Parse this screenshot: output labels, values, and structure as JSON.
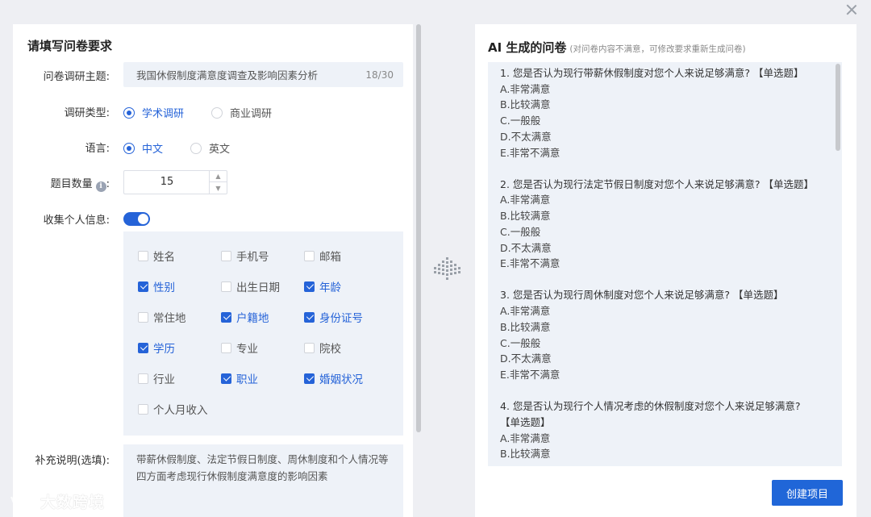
{
  "form": {
    "title": "请填写问卷要求",
    "topic": {
      "label": "问卷调研主题:",
      "value": "我国休假制度满意度调查及影响因素分析",
      "counter": "18/30"
    },
    "survey_type": {
      "label": "调研类型:",
      "options": [
        "学术调研",
        "商业调研"
      ],
      "selected": "学术调研"
    },
    "language": {
      "label": "语言:",
      "options": [
        "中文",
        "英文"
      ],
      "selected": "中文"
    },
    "question_count": {
      "label": "题目数量",
      "label_suffix": ":",
      "info_icon": "info-icon",
      "value": "15"
    },
    "collect_personal": {
      "label": "收集个人信息:",
      "enabled": true
    },
    "personal_fields": [
      {
        "label": "姓名",
        "checked": false
      },
      {
        "label": "手机号",
        "checked": false
      },
      {
        "label": "邮箱",
        "checked": false
      },
      {
        "label": "性别",
        "checked": true
      },
      {
        "label": "出生日期",
        "checked": false
      },
      {
        "label": "年龄",
        "checked": true
      },
      {
        "label": "常住地",
        "checked": false
      },
      {
        "label": "户籍地",
        "checked": true
      },
      {
        "label": "身份证号",
        "checked": true
      },
      {
        "label": "学历",
        "checked": true
      },
      {
        "label": "专业",
        "checked": false
      },
      {
        "label": "院校",
        "checked": false
      },
      {
        "label": "行业",
        "checked": false
      },
      {
        "label": "职业",
        "checked": true
      },
      {
        "label": "婚姻状况",
        "checked": true
      },
      {
        "label": "个人月收入",
        "checked": false
      }
    ],
    "note": {
      "label": "补充说明(选填):",
      "value": "带薪休假制度、法定节假日制度、周休制度和个人情况等四方面考虑现行休假制度满意度的影响因素"
    }
  },
  "result": {
    "title": "AI 生成的问卷",
    "subtitle": "(对问卷内容不满意，可修改要求重新生成问卷)",
    "questions": [
      {
        "stem": "1. 您是否认为现行带薪休假制度对您个人来说足够满意? 【单选题】",
        "options": [
          "A.非常满意",
          "B.比较满意",
          "C.一般般",
          "D.不太满意",
          "E.非常不满意"
        ]
      },
      {
        "stem": "2. 您是否认为现行法定节假日制度对您个人来说足够满意? 【单选题】",
        "options": [
          "A.非常满意",
          "B.比较满意",
          "C.一般般",
          "D.不太满意",
          "E.非常不满意"
        ]
      },
      {
        "stem": "3. 您是否认为现行周休制度对您个人来说足够满意? 【单选题】",
        "options": [
          "A.非常满意",
          "B.比较满意",
          "C.一般般",
          "D.不太满意",
          "E.非常不满意"
        ]
      },
      {
        "stem": "4. 您是否认为现行个人情况考虑的休假制度对您个人来说足够满意? 【单选题】",
        "options": [
          "A.非常满意",
          "B.比较满意"
        ]
      }
    ],
    "create_button": "创建项目"
  },
  "watermark": {
    "text": "大数跨境",
    "logo_icon": "watermark-logo-icon"
  },
  "colors": {
    "accent": "#2563d8",
    "panel_bg": "#eef2f8",
    "page_bg": "#eeeff3"
  }
}
